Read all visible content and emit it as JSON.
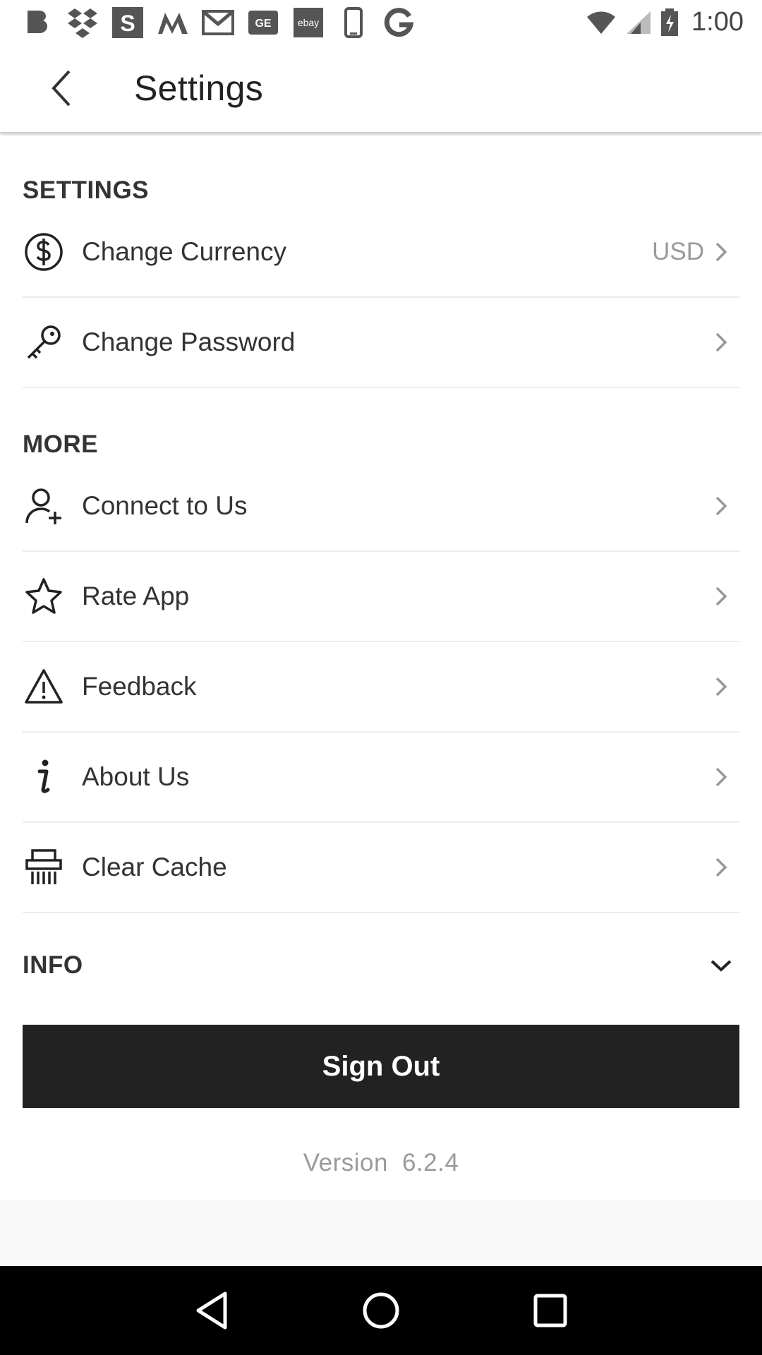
{
  "status_bar": {
    "time": "1:00",
    "notification_icons": [
      "b-app-icon",
      "dropbox-icon",
      "s-app-icon",
      "m-app-icon",
      "gmail-icon",
      "ge-app-icon",
      "ebay-icon",
      "phone-icon",
      "g-app-icon"
    ],
    "ebay_label": "ebay"
  },
  "app_bar": {
    "title": "Settings"
  },
  "sections": {
    "settings": {
      "header": "SETTINGS",
      "items": [
        {
          "label": "Change Currency",
          "value": "USD",
          "icon": "dollar-icon"
        },
        {
          "label": "Change Password",
          "icon": "key-icon"
        }
      ]
    },
    "more": {
      "header": "MORE",
      "items": [
        {
          "label": "Connect to Us",
          "icon": "add-user-icon"
        },
        {
          "label": "Rate App",
          "icon": "star-icon"
        },
        {
          "label": "Feedback",
          "icon": "warning-icon"
        },
        {
          "label": "About Us",
          "icon": "info-icon"
        },
        {
          "label": "Clear Cache",
          "icon": "shredder-icon"
        }
      ]
    },
    "info": {
      "header": "INFO"
    }
  },
  "sign_out": {
    "label": "Sign Out"
  },
  "version": {
    "label": "Version",
    "number": "6.2.4"
  },
  "colors": {
    "primary_button": "#222222",
    "muted_text": "#9a9a9a",
    "divider": "#ececec",
    "nav_bar": "#000000"
  }
}
